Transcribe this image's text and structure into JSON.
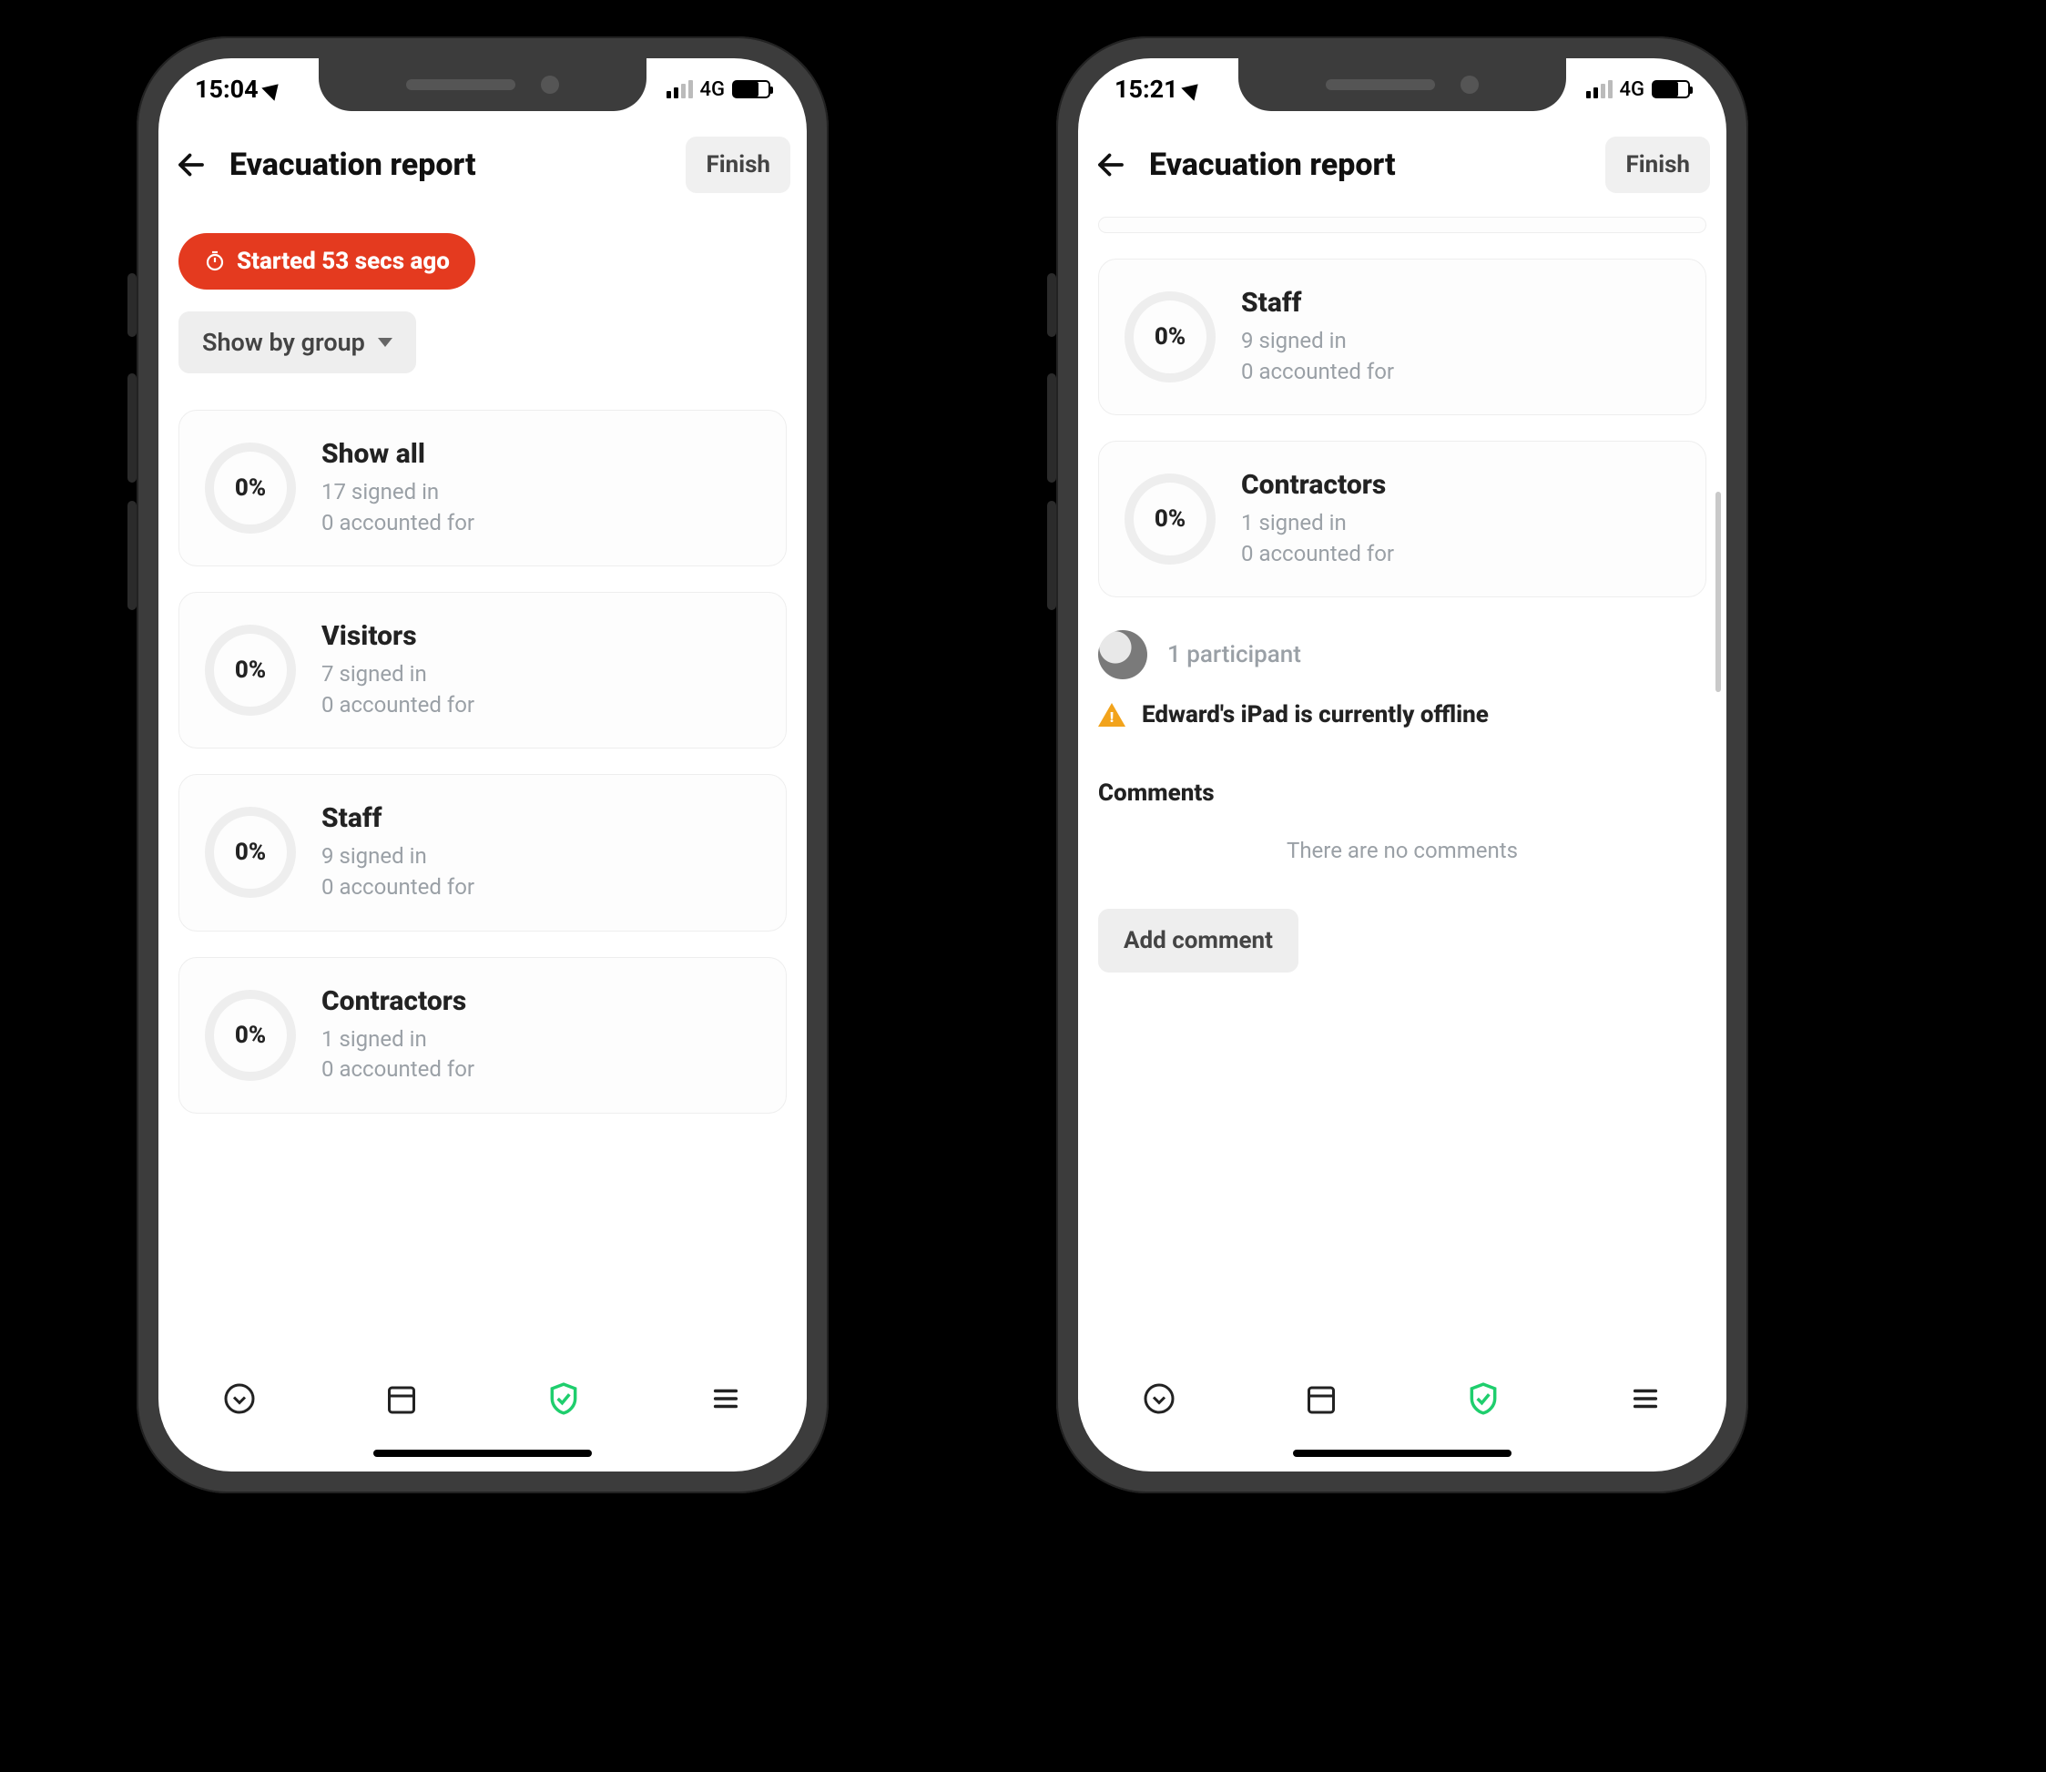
{
  "phoneA": {
    "status": {
      "time": "15:04",
      "network": "4G"
    },
    "header": {
      "title": "Evacuation report",
      "finish": "Finish"
    },
    "timer_chip": "Started 53 secs ago",
    "filter_chip": "Show by group",
    "groups": [
      {
        "pct": "0%",
        "title": "Show all",
        "signed": "17 signed in",
        "acct": "0 accounted for"
      },
      {
        "pct": "0%",
        "title": "Visitors",
        "signed": "7 signed in",
        "acct": "0 accounted for"
      },
      {
        "pct": "0%",
        "title": "Staff",
        "signed": "9 signed in",
        "acct": "0 accounted for"
      },
      {
        "pct": "0%",
        "title": "Contractors",
        "signed": "1 signed in",
        "acct": "0 accounted for"
      }
    ]
  },
  "phoneB": {
    "status": {
      "time": "15:21",
      "network": "4G"
    },
    "header": {
      "title": "Evacuation report",
      "finish": "Finish"
    },
    "groups": [
      {
        "pct": "0%",
        "title": "Staff",
        "signed": "9 signed in",
        "acct": "0 accounted for"
      },
      {
        "pct": "0%",
        "title": "Contractors",
        "signed": "1 signed in",
        "acct": "0 accounted for"
      }
    ],
    "participants_label": "1 participant",
    "warning": "Edward's iPad is currently offline",
    "comments_heading": "Comments",
    "comments_empty": "There are no comments",
    "add_comment": "Add comment"
  }
}
